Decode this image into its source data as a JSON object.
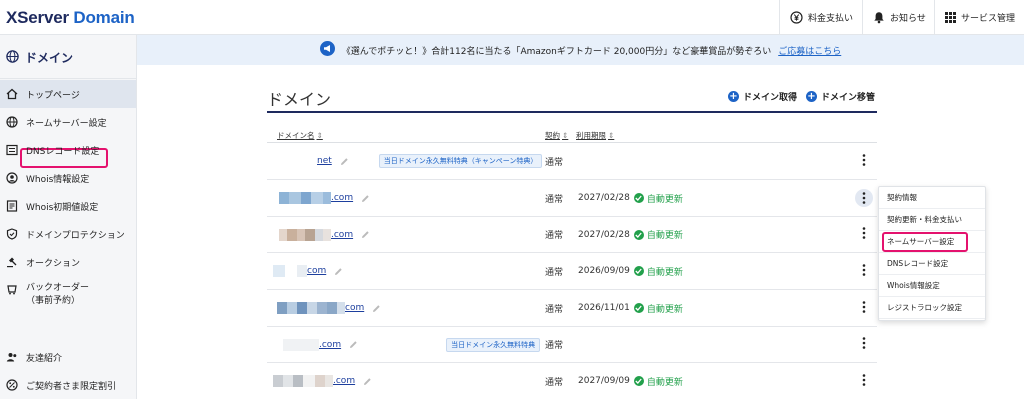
{
  "header": {
    "logo_main": "XServer",
    "logo_accent": "Domain",
    "billing_label": "料金支払い",
    "notice_label": "お知らせ",
    "service_label": "サービス管理"
  },
  "sidebar": {
    "title": "ドメイン",
    "items": [
      {
        "label": "トップページ",
        "icon": "home-icon"
      },
      {
        "label": "ネームサーバー設定",
        "icon": "nameserver-icon"
      },
      {
        "label": "DNSレコード設定",
        "icon": "dns-icon"
      },
      {
        "label": "Whois情報設定",
        "icon": "whois-icon"
      },
      {
        "label": "Whois初期値設定",
        "icon": "whois-default-icon"
      },
      {
        "label": "ドメインプロテクション",
        "icon": "shield-icon"
      },
      {
        "label": "オークション",
        "icon": "auction-icon"
      },
      {
        "label": "バックオーダー\n（事前予約）",
        "icon": "backorder-icon"
      },
      {
        "label": "友達紹介",
        "icon": "friend-icon"
      },
      {
        "label": "ご契約者さま限定割引",
        "icon": "discount-icon"
      }
    ]
  },
  "banner": {
    "text": "《選んでポチッと！》合計112名に当たる「Amazonギフトカード 20,000円分」など豪華賞品が勢ぞろい",
    "link": "ご応募はこちら"
  },
  "main": {
    "title": "ドメイン",
    "acquire_label": "ドメイン取得",
    "transfer_label": "ドメイン移管",
    "columns": [
      "ドメイン名",
      "契約",
      "利用期限"
    ],
    "sort_glyph": "⇕",
    "rows": [
      {
        "domain": "net",
        "badge": "当日ドメイン永久無料特典（キャンペーン特典）",
        "type": "通常",
        "date": "",
        "auto": ""
      },
      {
        "domain": ".com",
        "badge": "",
        "type": "通常",
        "date": "2027/02/28",
        "auto": "自動更新"
      },
      {
        "domain": ".com",
        "badge": "",
        "type": "通常",
        "date": "2027/02/28",
        "auto": "自動更新"
      },
      {
        "domain": "com",
        "badge": "",
        "type": "通常",
        "date": "2026/09/09",
        "auto": "自動更新"
      },
      {
        "domain": "com",
        "badge": "",
        "type": "通常",
        "date": "2026/11/01",
        "auto": "自動更新"
      },
      {
        "domain": ".com",
        "badge": "当日ドメイン永久無料特典",
        "type": "通常",
        "date": "",
        "auto": ""
      },
      {
        "domain": ".com",
        "badge": "",
        "type": "通常",
        "date": "2027/09/09",
        "auto": "自動更新"
      }
    ]
  },
  "dropdown": {
    "items": [
      "契約情報",
      "契約更新・料金支払い",
      "ネームサーバー設定",
      "DNSレコード設定",
      "Whois情報設定",
      "レジストラロック設定"
    ]
  },
  "colors": {
    "brand_navy": "#1e2a5e",
    "brand_blue": "#1d63c6",
    "auto_green": "#22a04b",
    "highlight": "#e4126e"
  }
}
